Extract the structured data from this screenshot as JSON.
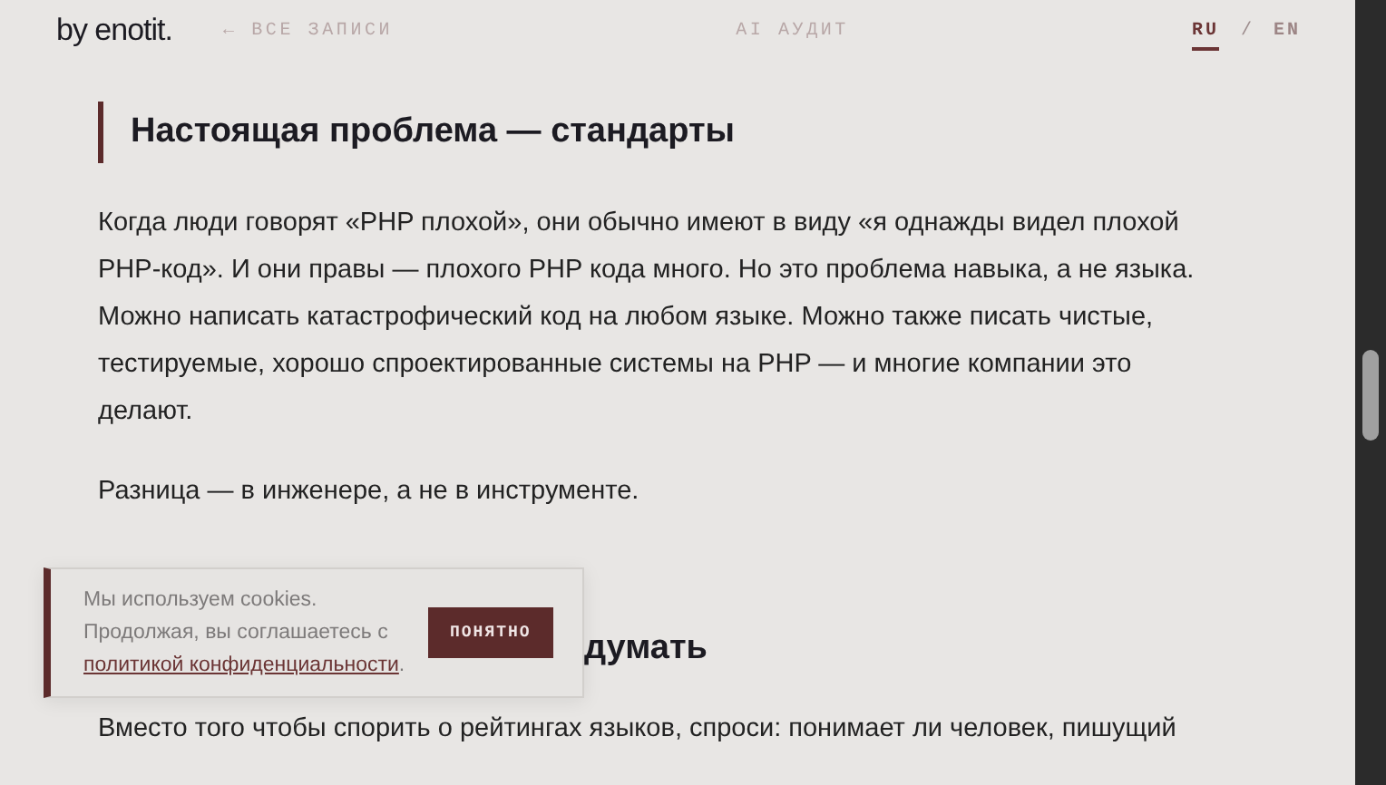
{
  "header": {
    "logo": "by enotit.",
    "back_link": "← ВСЕ ЗАПИСИ",
    "nav_link": "AI АУДИТ",
    "languages": [
      {
        "label": "RU",
        "selected": true
      },
      {
        "label": "EN",
        "selected": false
      }
    ],
    "language_separator": "/"
  },
  "article": [
    {
      "kind": "heading",
      "text": "Настоящая проблема — стандарты"
    },
    {
      "kind": "paragraph",
      "text": "Когда люди говорят «PHP плохой», они обычно имеют в виду «я однажды видел плохой PHP-код». И они правы — плохого PHP кода много. Но это проблема навыка, а не языка. Можно написать катастрофический код на любом языке. Можно также писать чистые, тестируемые, хорошо спроектированные системы на PHP — и многие компании это делают."
    },
    {
      "kind": "paragraph",
      "text": "Разница — в инженере, а не в инструменте."
    },
    {
      "kind": "partial_heading",
      "text": "думать"
    },
    {
      "kind": "paragraph",
      "text": "Вместо того чтобы спорить о рейтингах языков, спроси: понимает ли человек, пишущий"
    }
  ],
  "cookie_banner": {
    "text_before": "Мы используем cookies. Продолжая, вы соглашаетесь с ",
    "link": "политикой конфиденциальности",
    "text_after": ".",
    "button": "ПОНЯТНО"
  }
}
